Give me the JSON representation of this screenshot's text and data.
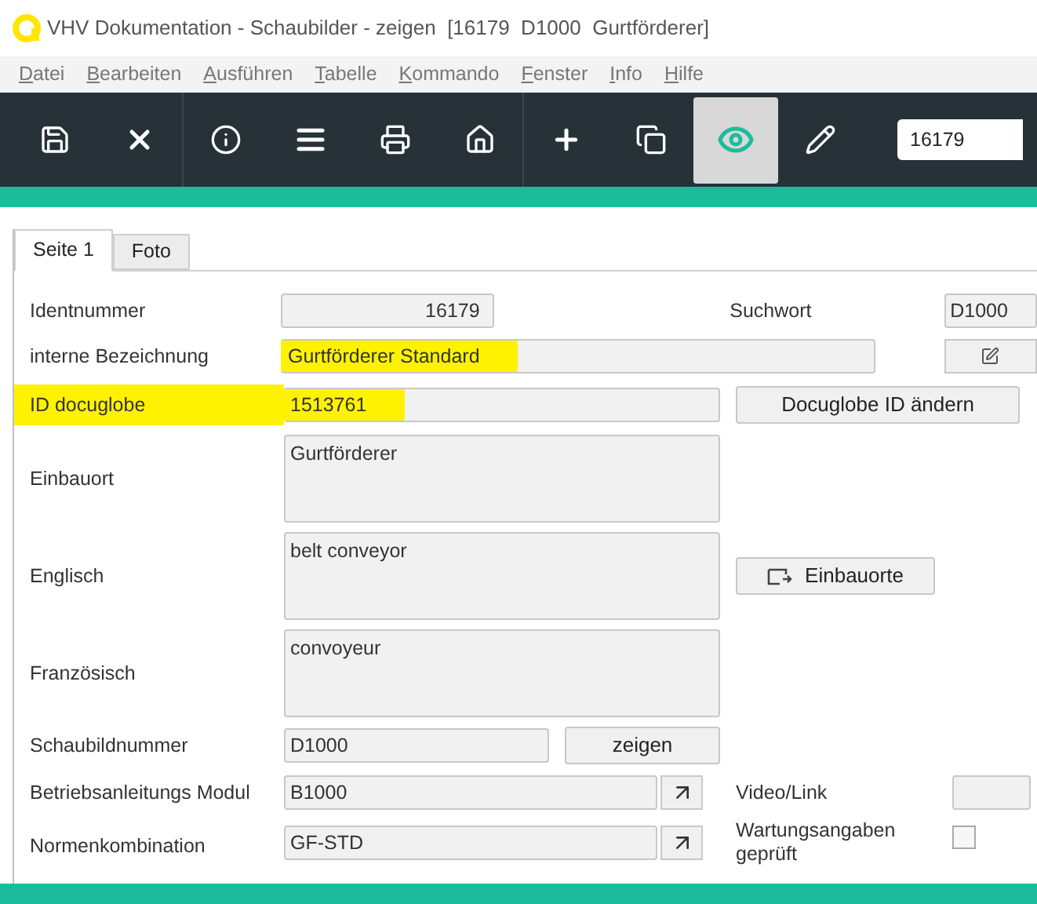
{
  "window": {
    "title": "VHV Dokumentation - Schaubilder - zeigen  [16179  D1000  Gurtförderer]"
  },
  "menu": [
    {
      "label": "Datei"
    },
    {
      "label": "Bearbeiten"
    },
    {
      "label": "Ausführen"
    },
    {
      "label": "Tabelle"
    },
    {
      "label": "Kommando"
    },
    {
      "label": "Fenster"
    },
    {
      "label": "Info"
    },
    {
      "label": "Hilfe"
    }
  ],
  "toolbar": {
    "groups": [
      [
        {
          "kind": "save",
          "selected": false
        },
        {
          "kind": "close",
          "selected": false
        }
      ],
      [
        {
          "kind": "info",
          "selected": false
        },
        {
          "kind": "list",
          "selected": false
        },
        {
          "kind": "print",
          "selected": false
        },
        {
          "kind": "home",
          "selected": false
        }
      ],
      [
        {
          "kind": "add",
          "selected": false
        },
        {
          "kind": "copy",
          "selected": false
        },
        {
          "kind": "view",
          "selected": true
        },
        {
          "kind": "edit",
          "selected": false
        }
      ]
    ],
    "search": {
      "value": "16179"
    }
  },
  "tabs": [
    {
      "label": "Seite 1",
      "selected": true
    },
    {
      "label": "Foto",
      "selected": false
    }
  ],
  "form": {
    "identnummer": {
      "label": "Identnummer",
      "value": "16179"
    },
    "suchwort": {
      "label": "Suchwort",
      "value": "D1000"
    },
    "interne_bezeichnung": {
      "label": "interne Bezeichnung",
      "value": "Gurtförderer Standard",
      "highlighted": true
    },
    "id_docuglobe": {
      "label": "ID docuglobe",
      "value": "1513761",
      "highlighted": true
    },
    "docuglobe_button": "Docuglobe ID ändern",
    "einbauort": {
      "label": "Einbauort",
      "value": "Gurtförderer"
    },
    "englisch": {
      "label": "Englisch",
      "value": "belt conveyor"
    },
    "einbauorte_button": "Einbauorte",
    "franzoesisch": {
      "label": "Französisch",
      "value": "convoyeur"
    },
    "schaubildnummer": {
      "label": "Schaubildnummer",
      "value": "D1000"
    },
    "zeigen_button": "zeigen",
    "betriebsanleitungs_modul": {
      "label": "Betriebsanleitungs Modul",
      "value": "B1000"
    },
    "video_link": {
      "label": "Video/Link"
    },
    "normenkombination": {
      "label": "Normenkombination",
      "value": "GF-STD"
    },
    "wartungsangaben": {
      "label": "Wartungsangaben geprüft",
      "checked": false
    }
  }
}
